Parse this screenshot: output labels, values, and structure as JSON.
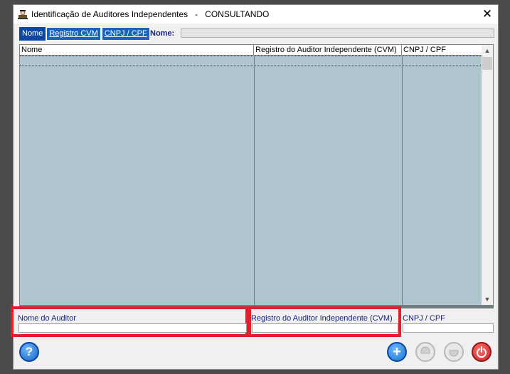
{
  "window": {
    "title": "Identificação de Auditores Independentes   -   CONSULTANDO",
    "close_glyph": "✕"
  },
  "tabs": [
    {
      "label": "Nome",
      "active": true
    },
    {
      "label": "Registro CVM",
      "active": false
    },
    {
      "label": "CNPJ / CPF",
      "active": false
    }
  ],
  "search": {
    "label": "Nome:",
    "value": ""
  },
  "grid": {
    "columns": [
      "Nome",
      "Registro do Auditor Independente (CVM)",
      "CNPJ / CPF"
    ],
    "rows": []
  },
  "detail": {
    "nome_label": "Nome do Auditor",
    "nome_value": "",
    "registro_label": "Registro do Auditor Independente (CVM)",
    "registro_value": "",
    "cnpj_label": "CNPJ / CPF",
    "cnpj_value": ""
  },
  "buttons": {
    "help_glyph": "?",
    "add_glyph": "+"
  },
  "colors": {
    "highlight": "#e0202a",
    "tab_bg": "#1565c0",
    "grid_bg": "#b0c4ce"
  },
  "icons": {
    "app": "auditor-app-icon",
    "help": "help-icon",
    "add": "add-icon",
    "edit": "edit-icon",
    "delete": "delete-icon",
    "power": "power-icon"
  }
}
